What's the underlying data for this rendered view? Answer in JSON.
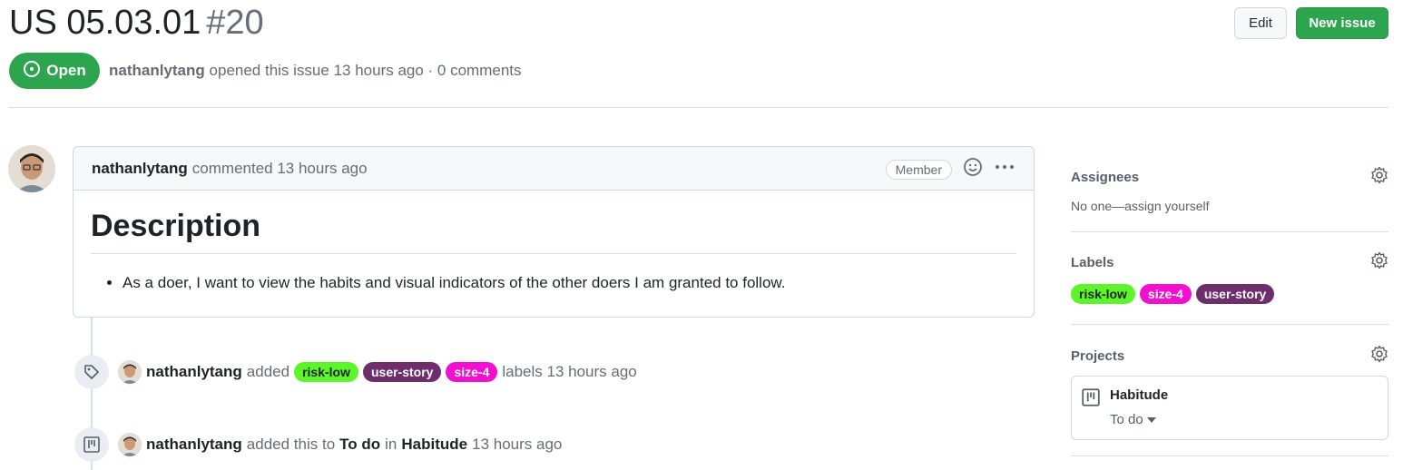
{
  "issue": {
    "title": "US 05.03.01",
    "number": "#20",
    "state": "Open",
    "author": "nathanlytang",
    "meta_text": "opened this issue 13 hours ago · 0 comments"
  },
  "header": {
    "edit_label": "Edit",
    "new_issue_label": "New issue"
  },
  "comment": {
    "author": "nathanlytang",
    "action": "commented 13 hours ago",
    "role_badge": "Member",
    "heading": "Description",
    "bullet": "As a doer, I want to view the habits and visual indicators of the other doers I am granted to follow."
  },
  "events": {
    "labels_event": {
      "author": "nathanlytang",
      "verb": "added",
      "labels": [
        {
          "name": "risk-low",
          "bg": "#5cf52a",
          "fg": "#1f2328"
        },
        {
          "name": "user-story",
          "bg": "#6e2d6b",
          "fg": "#ffffff"
        },
        {
          "name": "size-4",
          "bg": "#f30fd0",
          "fg": "#ffffff"
        }
      ],
      "suffix": "labels 13 hours ago"
    },
    "project_event": {
      "author": "nathanlytang",
      "verb": "added this to",
      "column": "To do",
      "in_word": "in",
      "project": "Habitude",
      "time": "13 hours ago"
    }
  },
  "sidebar": {
    "assignees": {
      "heading": "Assignees",
      "text": "No one—assign yourself"
    },
    "labels": {
      "heading": "Labels",
      "items": [
        {
          "name": "risk-low",
          "bg": "#5cf52a",
          "fg": "#1f2328"
        },
        {
          "name": "size-4",
          "bg": "#f30fd0",
          "fg": "#ffffff"
        },
        {
          "name": "user-story",
          "bg": "#6e2d6b",
          "fg": "#ffffff"
        }
      ]
    },
    "projects": {
      "heading": "Projects",
      "project_name": "Habitude",
      "column": "To do"
    }
  },
  "colors": {
    "open_green": "#2da44e",
    "muted_text": "#656d76",
    "border": "#d0d7de"
  },
  "icons": [
    "open-circle-icon",
    "smiley-icon",
    "kebab-icon",
    "tag-icon",
    "project-icon",
    "gear-icon",
    "caret-down-icon"
  ]
}
